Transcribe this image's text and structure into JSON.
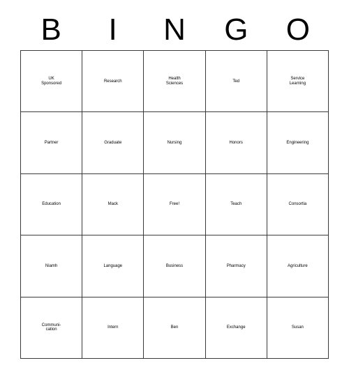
{
  "card": {
    "type": "bingo-card",
    "header": {
      "letters": [
        "B",
        "I",
        "N",
        "G",
        "O"
      ]
    },
    "free_space": {
      "row": 3,
      "column": 3,
      "label": "Free!"
    },
    "grid": {
      "columns": 5,
      "rows": 5,
      "cells": [
        [
          {
            "text": "UK\nSponsored",
            "size": "fs-xs"
          },
          {
            "text": "Research",
            "size": "fs-sm"
          },
          {
            "text": "Health\nSciences",
            "size": "fs-sm"
          },
          {
            "text": "Ted",
            "size": "fs-xxl"
          },
          {
            "text": "Service\nLearning",
            "size": "fs-sm"
          }
        ],
        [
          {
            "text": "Partner",
            "size": "fs-lg"
          },
          {
            "text": "Graduate",
            "size": "fs-md"
          },
          {
            "text": "Nursing",
            "size": "fs-lg"
          },
          {
            "text": "Honors",
            "size": "fs-lg"
          },
          {
            "text": "Engineering",
            "size": "fs-xs"
          }
        ],
        [
          {
            "text": "Education",
            "size": "fs-sm"
          },
          {
            "text": "Mack",
            "size": "fs-xxl"
          },
          {
            "text": "Free!",
            "size": "fs-xxl"
          },
          {
            "text": "Teach",
            "size": "fs-xxl"
          },
          {
            "text": "Consortia",
            "size": "fs-sm"
          }
        ],
        [
          {
            "text": "Niamh",
            "size": "fs-xl"
          },
          {
            "text": "Language",
            "size": "fs-md"
          },
          {
            "text": "Business",
            "size": "fs-md"
          },
          {
            "text": "Pharmacy",
            "size": "fs-md"
          },
          {
            "text": "Agriculture",
            "size": "fs-md"
          }
        ],
        [
          {
            "text": "Communi-\ncation",
            "size": "fs-sm"
          },
          {
            "text": "Intern",
            "size": "fs-xl"
          },
          {
            "text": "Ben",
            "size": "fs-xxl"
          },
          {
            "text": "Exchange",
            "size": "fs-sm"
          },
          {
            "text": "Susan",
            "size": "fs-xl"
          }
        ]
      ]
    },
    "colors": {
      "background": "#ffffff",
      "text": "#000000",
      "border": "#3a3a3a"
    }
  }
}
